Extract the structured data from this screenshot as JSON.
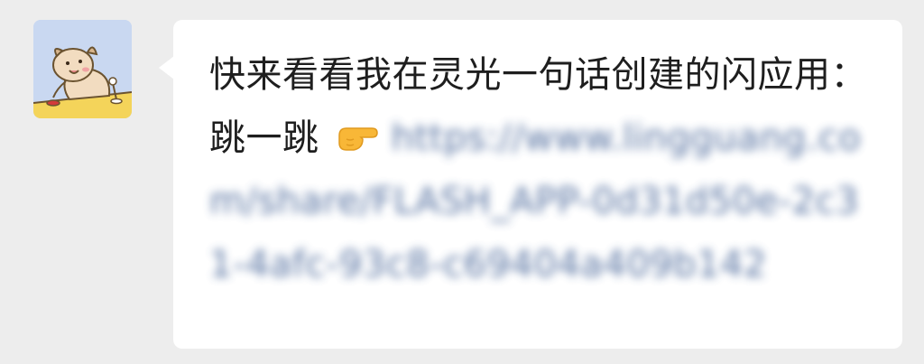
{
  "chat": {
    "message": {
      "text": "快来看看我在灵光一句话创建的闪应用：跳一跳",
      "emoji_icon": "pointing-hand-emoji",
      "link_text": "https://www.lingguang.com/share/FLASH_APP-0d31d50e-2c31-4afc-93c8-c6940​4a409b142"
    },
    "avatar": {
      "icon": "puppy-avatar-icon",
      "background": "#c9d8f1"
    }
  },
  "colors": {
    "background": "#ededed",
    "bubble": "#ffffff",
    "text": "#1e1e1e",
    "link": "#3b5b91"
  }
}
